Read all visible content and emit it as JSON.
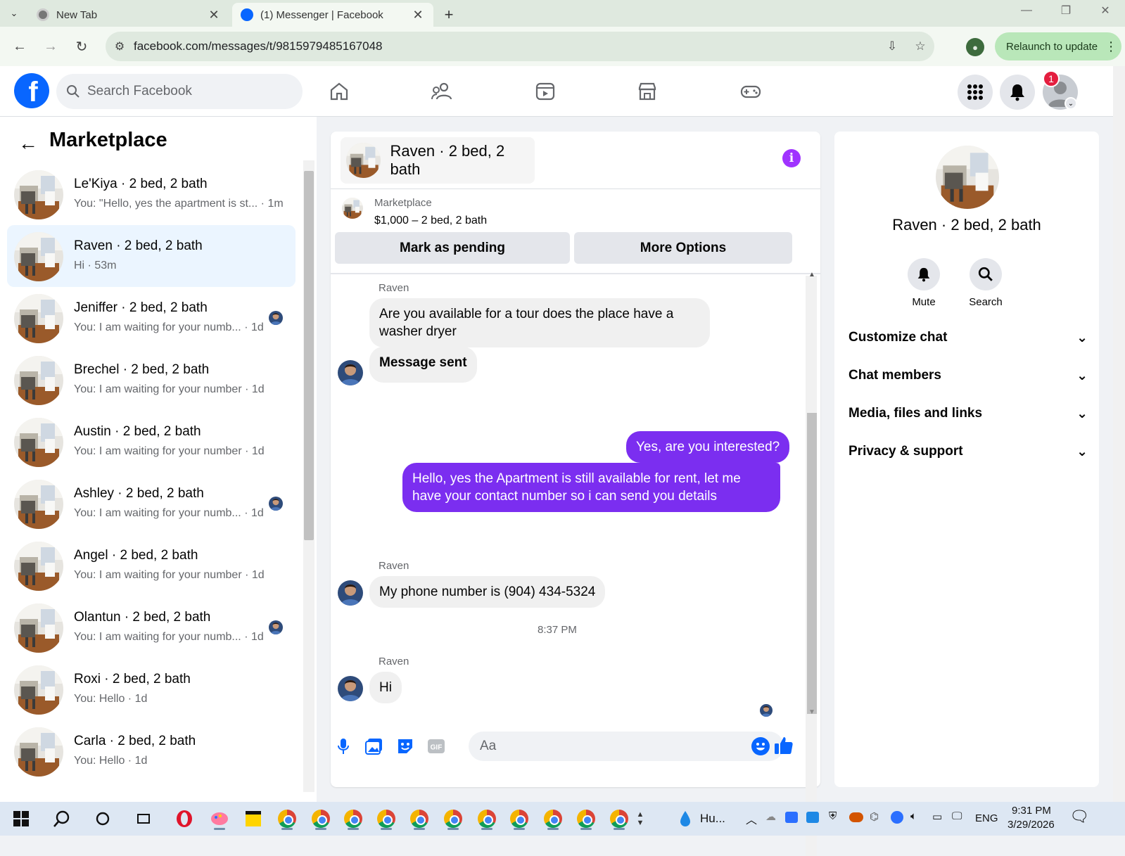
{
  "browser": {
    "tabs": [
      {
        "title": "New Tab",
        "active": false
      },
      {
        "title": "(1) Messenger | Facebook",
        "active": true
      }
    ],
    "url": "facebook.com/messages/t/9815979485167048",
    "relaunch_label": "Relaunch to update"
  },
  "fb_header": {
    "search_placeholder": "Search Facebook",
    "notification_count": "1",
    "nav_icons": [
      "home-icon",
      "friends-icon",
      "video-icon",
      "marketplace-icon",
      "gaming-icon"
    ]
  },
  "left_panel": {
    "title": "Marketplace",
    "conversations": [
      {
        "name": "Le'Kiya · 2 bed, 2 bath",
        "snippet": "You: \"Hello, yes the apartment is st... · 1m",
        "seen": false
      },
      {
        "name": "Raven · 2 bed, 2 bath",
        "snippet": "Hi · 53m",
        "seen": false,
        "active": true
      },
      {
        "name": "Jeniffer · 2 bed, 2 bath",
        "snippet": "You: I am waiting for your numb... · 1d",
        "seen": true
      },
      {
        "name": "Brechel · 2 bed, 2 bath",
        "snippet": "You: I am waiting for your number · 1d",
        "seen": false
      },
      {
        "name": "Austin · 2 bed, 2 bath",
        "snippet": "You: I am waiting for your number · 1d",
        "seen": false
      },
      {
        "name": "Ashley · 2 bed, 2 bath",
        "snippet": "You: I am waiting for your numb... · 1d",
        "seen": true
      },
      {
        "name": "Angel · 2 bed, 2 bath",
        "snippet": "You: I am waiting for your number · 1d",
        "seen": false
      },
      {
        "name": "Olantun · 2 bed, 2 bath",
        "snippet": "You: I am waiting for your numb... · 1d",
        "seen": true
      },
      {
        "name": "Roxi · 2 bed, 2 bath",
        "snippet": "You: Hello · 1d",
        "seen": false
      },
      {
        "name": "Carla · 2 bed, 2 bath",
        "snippet": "You: Hello · 1d",
        "seen": false
      }
    ]
  },
  "chat": {
    "title": "Raven · 2 bed, 2 bath",
    "listing": {
      "label": "Marketplace",
      "price": "$1,000 – 2 bed, 2 bath"
    },
    "mark_pending": "Mark as pending",
    "more_options": "More Options",
    "messages": [
      {
        "sender": "Raven",
        "text": "Are you available for a tour  does the place have a washer dryer",
        "dir": "in"
      },
      {
        "text": "Message sent",
        "dir": "in"
      },
      {
        "text": "Yes, are you interested?",
        "dir": "out"
      },
      {
        "text": "Hello, yes the Apartment is still available for rent, let me have your contact number so i can send you details",
        "dir": "out"
      },
      {
        "sender": "Raven",
        "text": "My phone number is (904) 434-5324",
        "dir": "in"
      },
      {
        "sender": "Raven",
        "text": "Hi",
        "dir": "in"
      }
    ],
    "timestamp": "8:37 PM",
    "composer_placeholder": "Aa"
  },
  "right_panel": {
    "name": "Raven · 2 bed, 2 bath",
    "actions": [
      "Mute",
      "Search"
    ],
    "sections": [
      "Customize chat",
      "Chat members",
      "Media, files and links",
      "Privacy & support"
    ]
  },
  "taskbar": {
    "weather": "Hu...",
    "lang": "ENG",
    "time": "9:31 PM",
    "date": "3/29/2026"
  },
  "colors": {
    "fb_blue": "#0866ff",
    "outgoing_bubble": "#7b2ef0",
    "active_conv": "#ebf5ff",
    "info_purple": "#a033ff"
  }
}
